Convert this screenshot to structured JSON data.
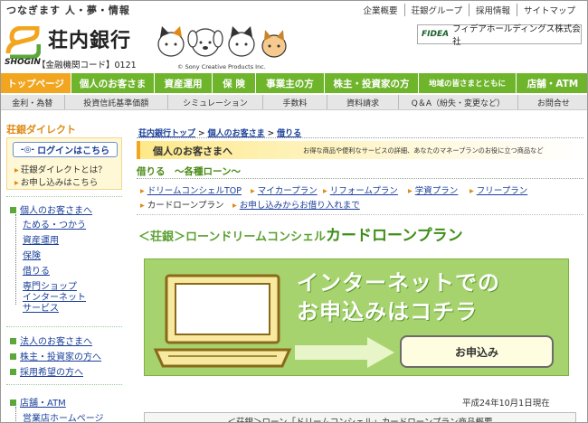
{
  "header": {
    "tagline": "つなぎます 人・夢・情報",
    "top_links": [
      "企業概要",
      "荘銀グループ",
      "採用情報",
      "サイトマップ"
    ],
    "bank_name": "荘内銀行",
    "shogin_mark": "SHOGIN",
    "institution_code": "【金融機関コード】0121",
    "copyright": "© Sony Creative Products Inc.",
    "fidea_mark": "FIDEA",
    "fidea_text": "フィデアホールディングス株式会社"
  },
  "nav": {
    "tabs": [
      "トップページ",
      "個人のお客さま",
      "資産運用",
      "保 険",
      "事業主の方",
      "株主・投資家の方",
      "地域の皆さまとともに",
      "店舗・ATM"
    ],
    "active_index": 0,
    "accent_color": "#6fb52c",
    "active_color": "#f2a51f"
  },
  "subnav": {
    "items": [
      "金利・為替",
      "投資信託基準価額",
      "シミュレーション",
      "手数料",
      "資料請求",
      "Q＆A（紛失・変更など）",
      "お問合せ"
    ]
  },
  "sidebar": {
    "direct_title": "荘銀ダイレクト",
    "login_button": "ログインはこちら",
    "login_links": [
      "荘銀ダイレクトとは？",
      "お申し込みはこちら"
    ],
    "personal": "個人のお客さまへ",
    "personal_items": [
      "ためる・つかう",
      "資産運用",
      "保険",
      "借りる",
      "専門ショップ",
      "インターネット\nサービス"
    ],
    "other_links": [
      "法人のお客さまへ",
      "株主・投資家の方へ",
      "採用希望の方へ"
    ],
    "store": "店舗・ATM",
    "store_items": [
      "営業店ホームページ"
    ]
  },
  "main": {
    "breadcrumb": [
      "荘内銀行トップ",
      "個人のお客さま",
      "借りる"
    ],
    "section_title": "個人のお客さまへ",
    "section_desc": "お得な商品や便利なサービスの詳細、あなたのマネープランのお役に立つ商品など",
    "subhead": "借りる　～各種ローン～",
    "loan_links_row1": [
      "ドリームコンシェルTOP",
      "マイカープラン",
      "リフォームプラン",
      "学資プラン",
      "フリープラン"
    ],
    "loan_links_row2": [
      "カードローンプラン",
      "お申し込みからお借り入れまで"
    ],
    "plan_title_prefix": "＜荘銀＞ローンドリームコンシェル",
    "plan_title_main": "カードローンプラン",
    "banner_line1": "インターネットでの",
    "banner_line2": "お申込みはコチラ",
    "apply_label": "お申込み",
    "as_of": "平成24年10月1日現在",
    "summary_title": "＜荘銀＞ローン「ドリームコンシェル」カードローンプラン商品概要"
  }
}
